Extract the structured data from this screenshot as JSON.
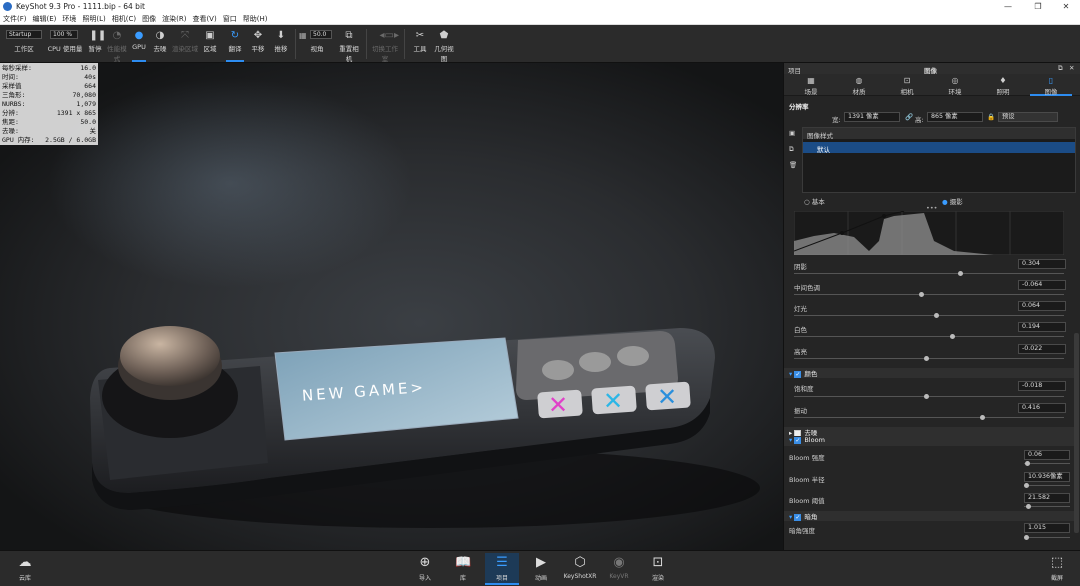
{
  "window": {
    "title": "KeyShot 9.3 Pro  -  1111.bip  -  64 bit",
    "min": "—",
    "max": "❐",
    "close": "✕"
  },
  "menu": [
    "文件(F)",
    "编辑(E)",
    "环境",
    "照明(L)",
    "相机(C)",
    "图像",
    "渲染(R)",
    "查看(V)",
    "窗口",
    "帮助(H)"
  ],
  "toolbar": {
    "workspace_select": "Startup",
    "workspace_label": "工作区",
    "cpu_percent": "100 %",
    "cpu_label": "CPU 使用量",
    "pause": "暂停",
    "perf_mode": "性能模式",
    "gpu": "GPU",
    "denoise": "去噪",
    "render_region": "渲染区域",
    "region": "区域",
    "refresh": "翻译",
    "pan": "平移",
    "dolly": "推移",
    "fov_value": "50.0",
    "fov_label": "视角",
    "reset_camera": "重置相机",
    "switch_workspace": "切换工作室",
    "tools": "工具",
    "geometry_view": "几何视图"
  },
  "stats": [
    {
      "k": "每秒采样:",
      "v": "16.0"
    },
    {
      "k": "时间:",
      "v": "40s"
    },
    {
      "k": "采样值",
      "v": "664"
    },
    {
      "k": "三角形:",
      "v": "70,080"
    },
    {
      "k": "NURBS:",
      "v": "1,079"
    },
    {
      "k": "分辨:",
      "v": "1391 x 865"
    },
    {
      "k": "焦距:",
      "v": "50.0"
    },
    {
      "k": "去噪:",
      "v": "关"
    },
    {
      "k": "GPU 内存:",
      "v": "2.5GB / 6.0GB"
    }
  ],
  "device": {
    "screen_text": "NEW GAME>"
  },
  "panel": {
    "left_title": "项目",
    "title": "图像",
    "tabs": [
      "场景",
      "材质",
      "相机",
      "环境",
      "照明",
      "图像"
    ],
    "resolution_label": "分辨率",
    "width_label": "宽:",
    "width_value": "1391 像素",
    "height_label": "高:",
    "height_value": "865 像素",
    "preset": "预设",
    "image_style_label": "图像样式",
    "style_default": "默认",
    "mode_basic": "基本",
    "mode_photo": "摄影",
    "sliders": [
      {
        "label": "阴影",
        "value": "0.304",
        "pos": 0.62
      },
      {
        "label": "中间色调",
        "value": "-0.064",
        "pos": 0.47
      },
      {
        "label": "灯光",
        "value": "0.064",
        "pos": 0.53
      },
      {
        "label": "白色",
        "value": "0.194",
        "pos": 0.59
      },
      {
        "label": "高亮",
        "value": "-0.022",
        "pos": 0.49
      }
    ],
    "color_section": "颜色",
    "color_sliders": [
      {
        "label": "饱和度",
        "value": "-0.018",
        "pos": 0.49
      },
      {
        "label": "振动",
        "value": "0.416",
        "pos": 0.7
      }
    ],
    "denoise_section": "去噪",
    "bloom_section": "Bloom",
    "bloom_sliders": [
      {
        "label": "Bloom 强度",
        "value": "0.06",
        "pos": 0.02
      },
      {
        "label": "Bloom 半径",
        "value": "10.936像素",
        "pos": 0.01
      },
      {
        "label": "Bloom 阈值",
        "value": "21.582",
        "pos": 0.05
      }
    ],
    "vignette_section": "暗角",
    "vignette_sliders": [
      {
        "label": "暗角强度",
        "value": "1.015",
        "pos": 0.0
      }
    ]
  },
  "bottom": {
    "cloud": "云库",
    "import": "导入",
    "library": "库",
    "project": "项目",
    "animation": "动画",
    "keyshotxr": "KeyShotXR",
    "keyvr": "KeyVR",
    "render": "渲染",
    "screenshot": "截屏"
  }
}
